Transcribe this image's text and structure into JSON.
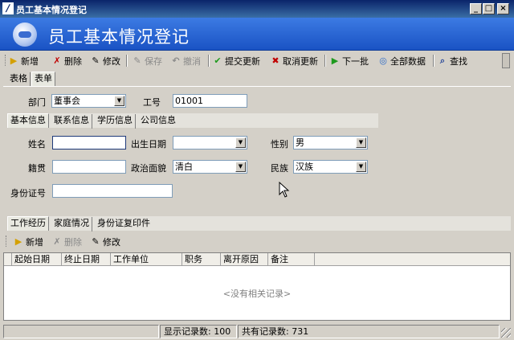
{
  "window": {
    "title": "员工基本情况登记",
    "controls": [
      "_",
      "□",
      "×"
    ]
  },
  "banner": {
    "title": "员工基本情况登记"
  },
  "toolbar": {
    "items": [
      {
        "label": "新增",
        "icon": "add-icon",
        "glyph": "▶",
        "color": "#d4a000",
        "disabled": false
      },
      {
        "label": "删除",
        "icon": "delete-icon",
        "glyph": "✗",
        "color": "#c00000",
        "disabled": false
      },
      {
        "label": "修改",
        "icon": "edit-icon",
        "glyph": "✎",
        "color": "#000000",
        "disabled": false
      },
      {
        "label": "保存",
        "icon": "save-icon",
        "glyph": "✎",
        "color": "#8a8a8a",
        "disabled": true
      },
      {
        "label": "撤消",
        "icon": "undo-icon",
        "glyph": "↶",
        "color": "#8a8a8a",
        "disabled": true
      },
      {
        "label": "提交更新",
        "icon": "check-icon",
        "glyph": "✔",
        "color": "#1e9a1e",
        "disabled": false
      },
      {
        "label": "取消更新",
        "icon": "cancel-icon",
        "glyph": "✖",
        "color": "#c00000",
        "disabled": false
      },
      {
        "label": "下一批",
        "icon": "next-batch-icon",
        "glyph": "▶",
        "color": "#1e9a1e",
        "disabled": false
      },
      {
        "label": "全部数据",
        "icon": "all-data-icon",
        "glyph": "◎",
        "color": "#2a6ac8",
        "disabled": false
      },
      {
        "label": "查找",
        "icon": "search-icon",
        "glyph": "⌕",
        "color": "#2a4a9a",
        "disabled": false
      }
    ]
  },
  "view_tabs": [
    "表格",
    "表单"
  ],
  "form": {
    "department_label": "部门",
    "department_value": "董事会",
    "employee_no_label": "工号",
    "employee_no_value": "01001"
  },
  "info_tabs": [
    "基本信息",
    "联系信息",
    "学历信息",
    "公司信息"
  ],
  "basic": {
    "name_label": "姓名",
    "name_value": "",
    "birthdate_label": "出生日期",
    "birthdate_value": "",
    "gender_label": "性别",
    "gender_value": "男",
    "native_label": "籍贯",
    "native_value": "",
    "political_label": "政治面貌",
    "political_value": "清白",
    "ethnic_label": "民族",
    "ethnic_value": "汉族",
    "idcard_label": "身份证号",
    "idcard_value": ""
  },
  "detail_tabs": [
    "工作经历",
    "家庭情况",
    "身份证复印件"
  ],
  "sub_toolbar": {
    "items": [
      {
        "label": "新增",
        "icon": "add-icon",
        "glyph": "▶",
        "color": "#d4a000",
        "disabled": false
      },
      {
        "label": "删除",
        "icon": "delete-icon",
        "glyph": "✗",
        "color": "#8a8a8a",
        "disabled": true
      },
      {
        "label": "修改",
        "icon": "edit-icon",
        "glyph": "✎",
        "color": "#000000",
        "disabled": false
      }
    ]
  },
  "grid": {
    "columns": [
      "起始日期",
      "终止日期",
      "工作单位",
      "职务",
      "离开原因",
      "备注"
    ],
    "empty_message": "<没有相关记录>"
  },
  "status": {
    "shown_records": "显示记录数: 100",
    "total_records": "共有记录数: 731"
  }
}
